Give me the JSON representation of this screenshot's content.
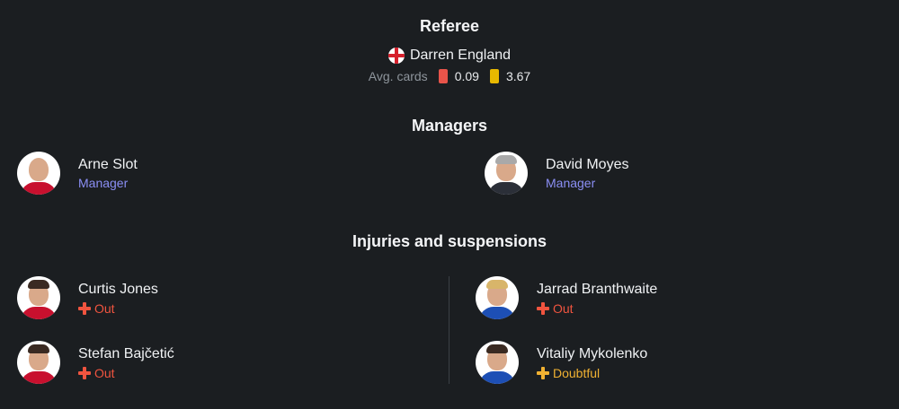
{
  "referee": {
    "title": "Referee",
    "name": "Darren England",
    "flag_icon": "england-flag-icon",
    "avg_cards_label": "Avg. cards",
    "red_avg": "0.09",
    "yellow_avg": "3.67",
    "colors": {
      "red_card": "#e8544a",
      "yellow_card": "#e8b800"
    }
  },
  "managers": {
    "title": "Managers",
    "items": [
      {
        "name": "Arne Slot",
        "role": "Manager"
      },
      {
        "name": "David Moyes",
        "role": "Manager"
      }
    ]
  },
  "injuries": {
    "title": "Injuries and suspensions",
    "left": [
      {
        "name": "Curtis Jones",
        "status": "Out"
      },
      {
        "name": "Stefan Bajčetić",
        "status": "Out"
      }
    ],
    "right": [
      {
        "name": "Jarrad Branthwaite",
        "status": "Out"
      },
      {
        "name": "Vitaliy Mykolenko",
        "status": "Doubtful"
      }
    ],
    "colors": {
      "out": "#f0543f",
      "doubtful": "#f0b132"
    }
  },
  "theme": {
    "background": "#1b1e21",
    "accent_role": "#8b8ff5"
  }
}
